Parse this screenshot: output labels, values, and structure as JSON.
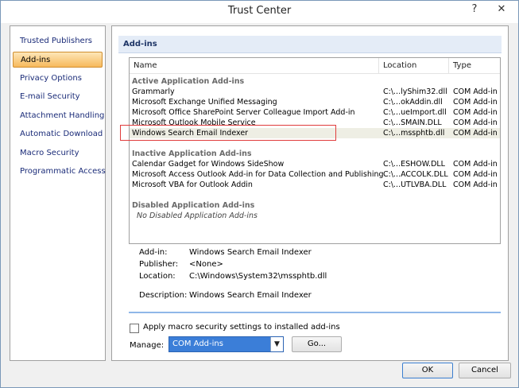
{
  "window": {
    "title": "Trust Center",
    "help_glyph": "?",
    "close_glyph": "✕"
  },
  "sidebar": {
    "items": [
      {
        "label": "Trusted Publishers",
        "selected": false
      },
      {
        "label": "Add-ins",
        "selected": true
      },
      {
        "label": "Privacy Options",
        "selected": false
      },
      {
        "label": "E-mail Security",
        "selected": false
      },
      {
        "label": "Attachment Handling",
        "selected": false
      },
      {
        "label": "Automatic Download",
        "selected": false
      },
      {
        "label": "Macro Security",
        "selected": false
      },
      {
        "label": "Programmatic Access",
        "selected": false
      }
    ]
  },
  "main": {
    "section_title": "Add-ins",
    "columns": {
      "name": "Name",
      "location": "Location",
      "type": "Type"
    },
    "groups": {
      "active": "Active Application Add-ins",
      "inactive": "Inactive Application Add-ins",
      "disabled": "Disabled Application Add-ins",
      "disabled_empty": "No Disabled Application Add-ins"
    },
    "active_rows": [
      {
        "name": "Grammarly",
        "location": "C:\\...lyShim32.dll",
        "type": "COM Add-in"
      },
      {
        "name": "Microsoft Exchange Unified Messaging",
        "location": "C:\\...okAddin.dll",
        "type": "COM Add-in"
      },
      {
        "name": "Microsoft Office SharePoint Server Colleague Import Add-in",
        "location": "C:\\...ueImport.dll",
        "type": "COM Add-in"
      },
      {
        "name": "Microsoft Outlook Mobile Service",
        "location": "C:\\...SMAIN.DLL",
        "type": "COM Add-in"
      },
      {
        "name": "Windows Search Email Indexer",
        "location": "C:\\...mssphtb.dll",
        "type": "COM Add-in"
      }
    ],
    "inactive_rows": [
      {
        "name": "Calendar Gadget for Windows SideShow",
        "location": "C:\\...ESHOW.DLL",
        "type": "COM Add-in"
      },
      {
        "name": "Microsoft Access Outlook Add-in for Data Collection and Publishing",
        "location": "C:\\...ACCOLK.DLL",
        "type": "COM Add-in"
      },
      {
        "name": "Microsoft VBA for Outlook Addin",
        "location": "C:\\...UTLVBA.DLL",
        "type": "COM Add-in"
      }
    ],
    "details": {
      "addin_label": "Add-in:",
      "addin_value": "Windows Search Email Indexer",
      "publisher_label": "Publisher:",
      "publisher_value": "<None>",
      "location_label": "Location:",
      "location_value": "C:\\Windows\\System32\\mssphtb.dll",
      "description_label": "Description:",
      "description_value": "Windows Search Email Indexer"
    },
    "macro_checkbox_label": "Apply macro security settings to installed add-ins",
    "macro_checkbox_checked": false,
    "manage_label": "Manage:",
    "manage_value": "COM Add-ins",
    "go_label": "Go..."
  },
  "footer": {
    "ok_label": "OK",
    "cancel_label": "Cancel"
  },
  "colors": {
    "selection_highlight": "#e03c3c",
    "dropdown": "#3b7ed8",
    "nav_selected": "#f7b95c"
  }
}
